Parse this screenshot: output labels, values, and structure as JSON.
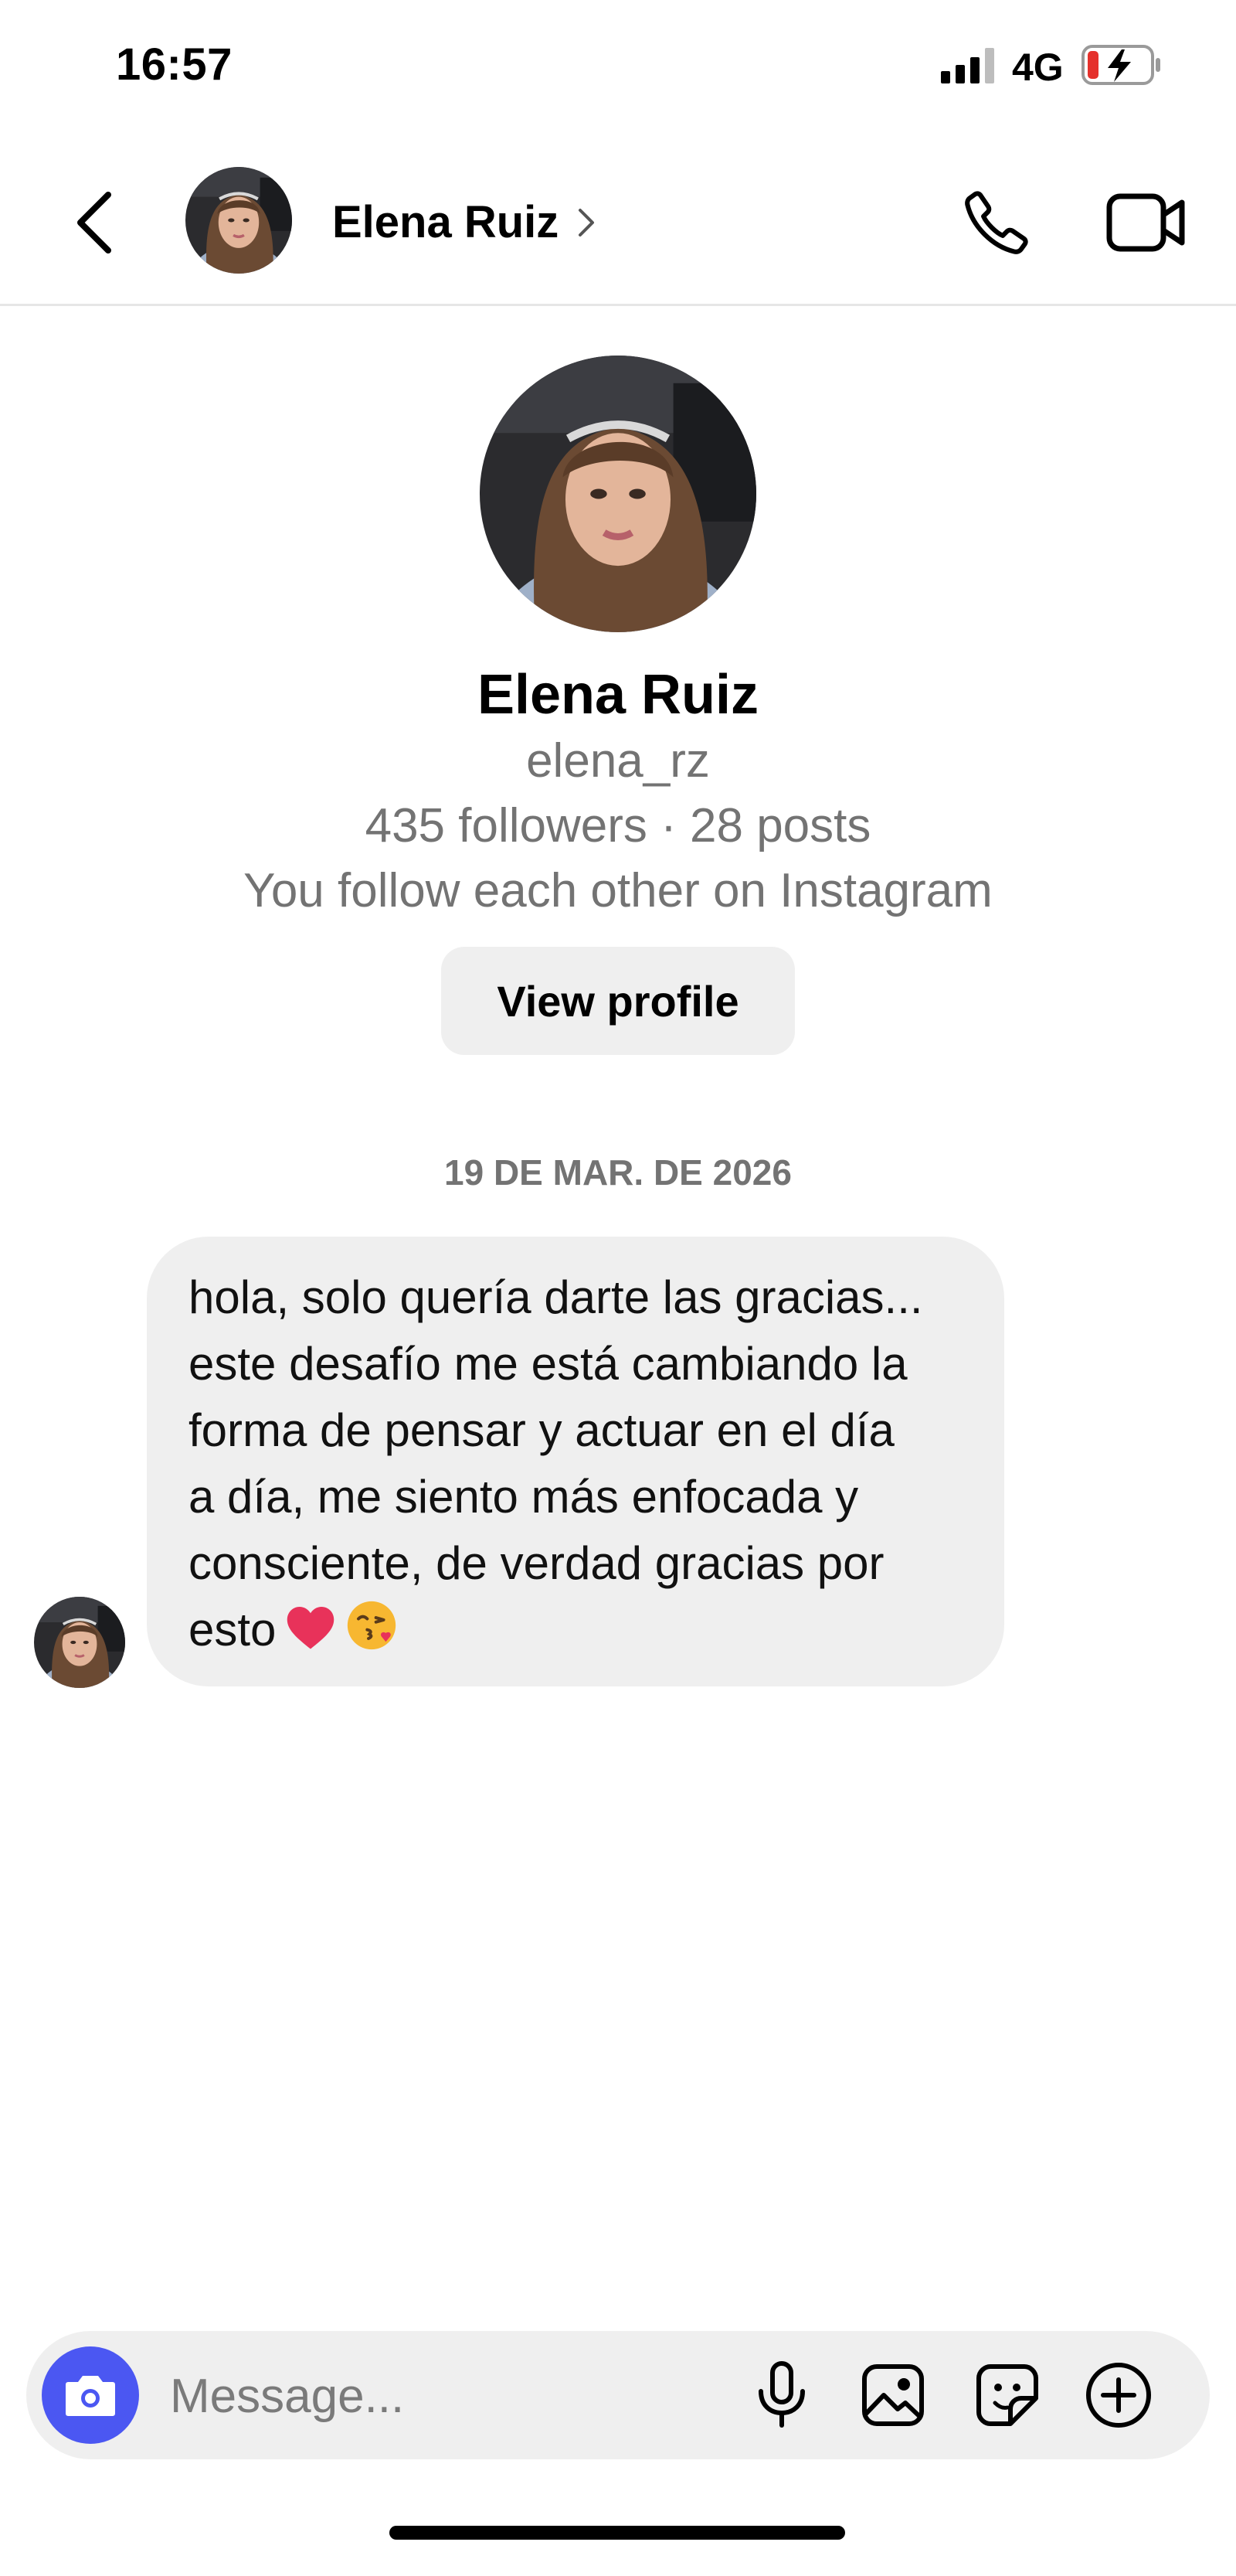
{
  "status_bar": {
    "time": "16:57",
    "network": "4G",
    "icons": [
      "signal-bars-icon",
      "battery-charging-icon"
    ]
  },
  "header": {
    "back_icon": "chevron-left-icon",
    "name": "Elena Ruiz",
    "name_chevron_icon": "chevron-right-icon",
    "actions": [
      "phone-icon",
      "video-camera-icon"
    ]
  },
  "profile": {
    "name": "Elena Ruiz",
    "handle": "elena_rz",
    "stats": "435 followers · 28 posts",
    "relationship": "You follow each other on Instagram",
    "view_profile_label": "View profile"
  },
  "conversation": {
    "date_label": "19 DE MAR. DE 2026",
    "messages": [
      {
        "sender": "Elena Ruiz",
        "text": "hola, solo quería darte las gracias...\neste desafío me está cambiando la\nforma de pensar y actuar en el día\na día, me siento más enfocada y\nconsciente, de verdad gracias por\nesto",
        "emojis": [
          "red-heart-emoji",
          "face-blowing-kiss-emoji"
        ]
      }
    ]
  },
  "composer": {
    "placeholder": "Message...",
    "icons": [
      "camera-icon",
      "microphone-icon",
      "gallery-icon",
      "sticker-icon",
      "plus-circle-icon"
    ]
  },
  "colors": {
    "accent": "#4b57f2",
    "bubble": "#efefef",
    "secondary_text": "#737373",
    "heart": "#e8325a"
  }
}
